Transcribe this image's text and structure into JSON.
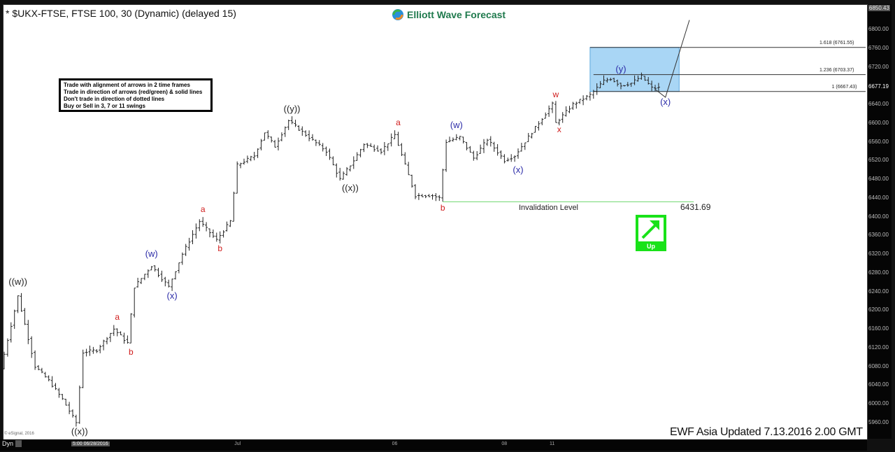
{
  "header": {
    "title": "* $UKX-FTSE, FTSE 100, 30 (Dynamic) (delayed 15)",
    "logo_text": "Elliott Wave Forecast"
  },
  "rules_box": {
    "lines": [
      "Trade with alignment of arrows in 2 time frames",
      "Trade in direction of arrows (red/green) & solid lines",
      "Don't trade in direction of dotted lines",
      "Buy or Sell in 3, 7 or 11 swings"
    ]
  },
  "footer": {
    "updated": "EWF Asia Updated 7.13.2016 2.00 GMT",
    "copyright": "© eSignal, 2016",
    "dyn_label": "Dyn",
    "cursor_time": "5:00 06/28/2016"
  },
  "signal": {
    "label": "Up",
    "color": "#19e219"
  },
  "chart_data": {
    "type": "ohlc",
    "title": "$UKX-FTSE, FTSE 100, 30 (Dynamic) (delayed 15)",
    "xlabel": "",
    "ylabel": "",
    "ylim": [
      5935,
      6860
    ],
    "yticks": [
      "6800.00",
      "6760.00",
      "6720.00",
      "6680.00",
      "6640.00",
      "6600.00",
      "6560.00",
      "6520.00",
      "6480.00",
      "6440.00",
      "6400.00",
      "6360.00",
      "6320.00",
      "6280.00",
      "6240.00",
      "6200.00",
      "6160.00",
      "6120.00",
      "6080.00",
      "6040.00",
      "6000.00",
      "5960.00"
    ],
    "ytick_values": [
      6800,
      6760,
      6720,
      6680,
      6640,
      6600,
      6560,
      6520,
      6480,
      6440,
      6400,
      6360,
      6320,
      6280,
      6240,
      6200,
      6160,
      6120,
      6080,
      6040,
      6000,
      5960
    ],
    "top_price_label": "6850.43",
    "last_price": "6677.19",
    "xticks": [
      {
        "label": "Jul",
        "bar": 68
      },
      {
        "label": "06",
        "bar": 114
      },
      {
        "label": "08",
        "bar": 146
      },
      {
        "label": "11",
        "bar": 160
      }
    ],
    "grid": false,
    "colors": {
      "bars": "#222222",
      "fib_zone": "#a9d6f5",
      "invalidation": "#7fdc7f",
      "projection": "#333333"
    },
    "price_path": [
      {
        "bar": 0,
        "price": 6075
      },
      {
        "bar": 5,
        "price": 6230
      },
      {
        "bar": 10,
        "price": 6080
      },
      {
        "bar": 14,
        "price": 6050
      },
      {
        "bar": 18,
        "price": 6010
      },
      {
        "bar": 22,
        "price": 5960
      },
      {
        "bar": 24,
        "price": 6110
      },
      {
        "bar": 28,
        "price": 6115
      },
      {
        "bar": 33,
        "price": 6160
      },
      {
        "bar": 37,
        "price": 6130
      },
      {
        "bar": 39,
        "price": 6250
      },
      {
        "bar": 44,
        "price": 6295
      },
      {
        "bar": 49,
        "price": 6250
      },
      {
        "bar": 53,
        "price": 6320
      },
      {
        "bar": 58,
        "price": 6390
      },
      {
        "bar": 63,
        "price": 6350
      },
      {
        "bar": 67,
        "price": 6390
      },
      {
        "bar": 69,
        "price": 6510
      },
      {
        "bar": 74,
        "price": 6530
      },
      {
        "bar": 77,
        "price": 6580
      },
      {
        "bar": 80,
        "price": 6550
      },
      {
        "bar": 84,
        "price": 6605
      },
      {
        "bar": 89,
        "price": 6575
      },
      {
        "bar": 95,
        "price": 6540
      },
      {
        "bar": 99,
        "price": 6480
      },
      {
        "bar": 103,
        "price": 6520
      },
      {
        "bar": 106,
        "price": 6555
      },
      {
        "bar": 111,
        "price": 6540
      },
      {
        "bar": 115,
        "price": 6575
      },
      {
        "bar": 118,
        "price": 6510
      },
      {
        "bar": 121,
        "price": 6445
      },
      {
        "bar": 126,
        "price": 6445
      },
      {
        "bar": 128,
        "price": 6440
      },
      {
        "bar": 130,
        "price": 6560
      },
      {
        "bar": 134,
        "price": 6570
      },
      {
        "bar": 138,
        "price": 6525
      },
      {
        "bar": 142,
        "price": 6565
      },
      {
        "bar": 147,
        "price": 6520
      },
      {
        "bar": 150,
        "price": 6530
      },
      {
        "bar": 155,
        "price": 6580
      },
      {
        "bar": 158,
        "price": 6610
      },
      {
        "bar": 161,
        "price": 6640
      },
      {
        "bar": 162,
        "price": 6600
      },
      {
        "bar": 167,
        "price": 6640
      },
      {
        "bar": 172,
        "price": 6660
      },
      {
        "bar": 176,
        "price": 6690
      },
      {
        "bar": 178,
        "price": 6695
      },
      {
        "bar": 181,
        "price": 6680
      },
      {
        "bar": 184,
        "price": 6685
      },
      {
        "bar": 187,
        "price": 6700
      },
      {
        "bar": 190,
        "price": 6675
      },
      {
        "bar": 192,
        "price": 6675
      }
    ],
    "wave_labels": [
      {
        "text": "((w))",
        "bar": 4,
        "price": 6245,
        "color": "black",
        "pos": "above"
      },
      {
        "text": "((x))",
        "bar": 22,
        "price": 5955,
        "color": "black",
        "pos": "below"
      },
      {
        "text": "a",
        "bar": 33,
        "price": 6170,
        "color": "red",
        "pos": "above"
      },
      {
        "text": "b",
        "bar": 37,
        "price": 6125,
        "color": "red",
        "pos": "below"
      },
      {
        "text": "(w)",
        "bar": 43,
        "price": 6305,
        "color": "blue",
        "pos": "above"
      },
      {
        "text": "(x)",
        "bar": 49,
        "price": 6245,
        "color": "blue",
        "pos": "below"
      },
      {
        "text": "a",
        "bar": 58,
        "price": 6400,
        "color": "red",
        "pos": "above"
      },
      {
        "text": "b",
        "bar": 63,
        "price": 6345,
        "color": "red",
        "pos": "below"
      },
      {
        "text": "((y))",
        "bar": 84,
        "price": 6615,
        "color": "black",
        "pos": "above"
      },
      {
        "text": "((x))",
        "bar": 101,
        "price": 6475,
        "color": "black",
        "pos": "below"
      },
      {
        "text": "a",
        "bar": 115,
        "price": 6585,
        "color": "red",
        "pos": "above"
      },
      {
        "text": "b",
        "bar": 128,
        "price": 6432,
        "color": "red",
        "pos": "below"
      },
      {
        "text": "(w)",
        "bar": 132,
        "price": 6580,
        "color": "blue",
        "pos": "above"
      },
      {
        "text": "(x)",
        "bar": 150,
        "price": 6515,
        "color": "blue",
        "pos": "below"
      },
      {
        "text": "w",
        "bar": 161,
        "price": 6645,
        "color": "red",
        "pos": "above"
      },
      {
        "text": "x",
        "bar": 162,
        "price": 6600,
        "color": "red",
        "pos": "below"
      },
      {
        "text": "(y)",
        "bar": 180,
        "price": 6700,
        "color": "blue",
        "pos": "above"
      },
      {
        "text": "(x)",
        "bar": 193,
        "price": 6660,
        "color": "blue",
        "pos": "below"
      }
    ],
    "fib_levels": [
      {
        "ratio": "1.618",
        "price": 6761.55,
        "label": "1.618 (6761.55)"
      },
      {
        "ratio": "1.236",
        "price": 6703.37,
        "label": "1.236 (6703.37)"
      },
      {
        "ratio": "1",
        "price": 6667.43,
        "label": "1 (6667.43)"
      }
    ],
    "fib_zone": {
      "from_price": 6667.43,
      "to_price": 6761.55,
      "from_bar": 171,
      "to_bar": 197
    },
    "invalidation": {
      "label": "Invalidation Level",
      "price": 6431.69,
      "value_label": "6431.69",
      "from_bar": 128,
      "to_bar": 198
    },
    "projection": [
      {
        "bar": 190,
        "price": 6672
      },
      {
        "bar": 193,
        "price": 6655
      },
      {
        "bar": 200,
        "price": 6820
      }
    ]
  }
}
